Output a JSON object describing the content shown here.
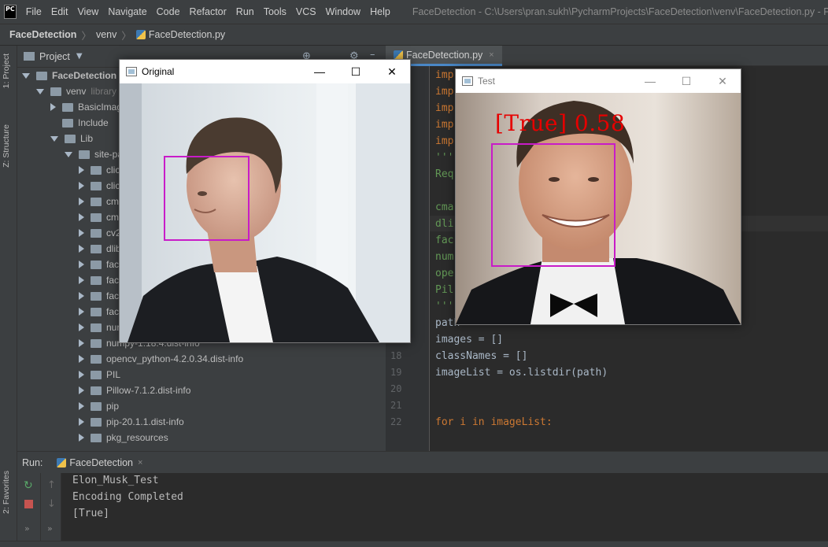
{
  "app": {
    "logo_text": "PC",
    "menu": [
      "File",
      "Edit",
      "View",
      "Navigate",
      "Code",
      "Refactor",
      "Run",
      "Tools",
      "VCS",
      "Window",
      "Help"
    ],
    "window_title": "FaceDetection - C:\\Users\\pran.sukh\\PycharmProjects\\FaceDetection\\venv\\FaceDetection.py - PyCharm"
  },
  "breadcrumb": [
    "FaceDetection",
    "venv",
    "FaceDetection.py"
  ],
  "left_stripe": {
    "tab1": "1: Project",
    "tab2": "Z: Structure",
    "tab3": "2: Favorites"
  },
  "project": {
    "title": "Project",
    "tree": [
      {
        "label": "FaceDetection",
        "extra": ""
      },
      {
        "label": "venv",
        "extra": "library r"
      },
      {
        "label": "BasicImag",
        "extra": ""
      },
      {
        "label": "Include",
        "extra": ""
      },
      {
        "label": "Lib",
        "extra": ""
      },
      {
        "label": "site-pa",
        "extra": ""
      },
      {
        "label": "clic",
        "extra": ""
      },
      {
        "label": "clic",
        "extra": ""
      },
      {
        "label": "cm",
        "extra": ""
      },
      {
        "label": "cm",
        "extra": ""
      },
      {
        "label": "cv2",
        "extra": ""
      },
      {
        "label": "dlib",
        "extra": ""
      },
      {
        "label": "face",
        "extra": ""
      },
      {
        "label": "face",
        "extra": ""
      },
      {
        "label": "face",
        "extra": ""
      },
      {
        "label": "face",
        "extra": ""
      },
      {
        "label": "nur",
        "extra": ""
      },
      {
        "label": "numpy-1.18.4.dist-info",
        "extra": ""
      },
      {
        "label": "opencv_python-4.2.0.34.dist-info",
        "extra": ""
      },
      {
        "label": "PIL",
        "extra": ""
      },
      {
        "label": "Pillow-7.1.2.dist-info",
        "extra": ""
      },
      {
        "label": "pip",
        "extra": ""
      },
      {
        "label": "pip-20.1.1.dist-info",
        "extra": ""
      },
      {
        "label": "pkg_resources",
        "extra": ""
      }
    ]
  },
  "editor": {
    "tab": "FaceDetection.py",
    "line_numbers": [
      "18",
      "19",
      "20",
      "21",
      "22"
    ],
    "code": [
      "imp",
      "imp",
      "imp",
      "imp",
      "imp",
      "'''",
      "Req",
      "cma",
      "dli",
      "fac",
      "num",
      "ope",
      "Pil",
      "'''",
      "path",
      "images = []",
      "classNames = []",
      "imageList = os.listdir(path)",
      "",
      "",
      "for i in imageList:"
    ]
  },
  "run": {
    "label": "Run:",
    "tab": "FaceDetection",
    "output": [
      "Elon_Musk_Test",
      "Encoding Completed",
      "[True]"
    ]
  },
  "windows": {
    "original": {
      "title": "Original"
    },
    "test": {
      "title": "Test",
      "match_label": "[True] 0.58"
    }
  },
  "colors": {
    "face_box": "#c81cc8",
    "match_label": "#e60000",
    "accent_tab": "#4a88c7"
  }
}
